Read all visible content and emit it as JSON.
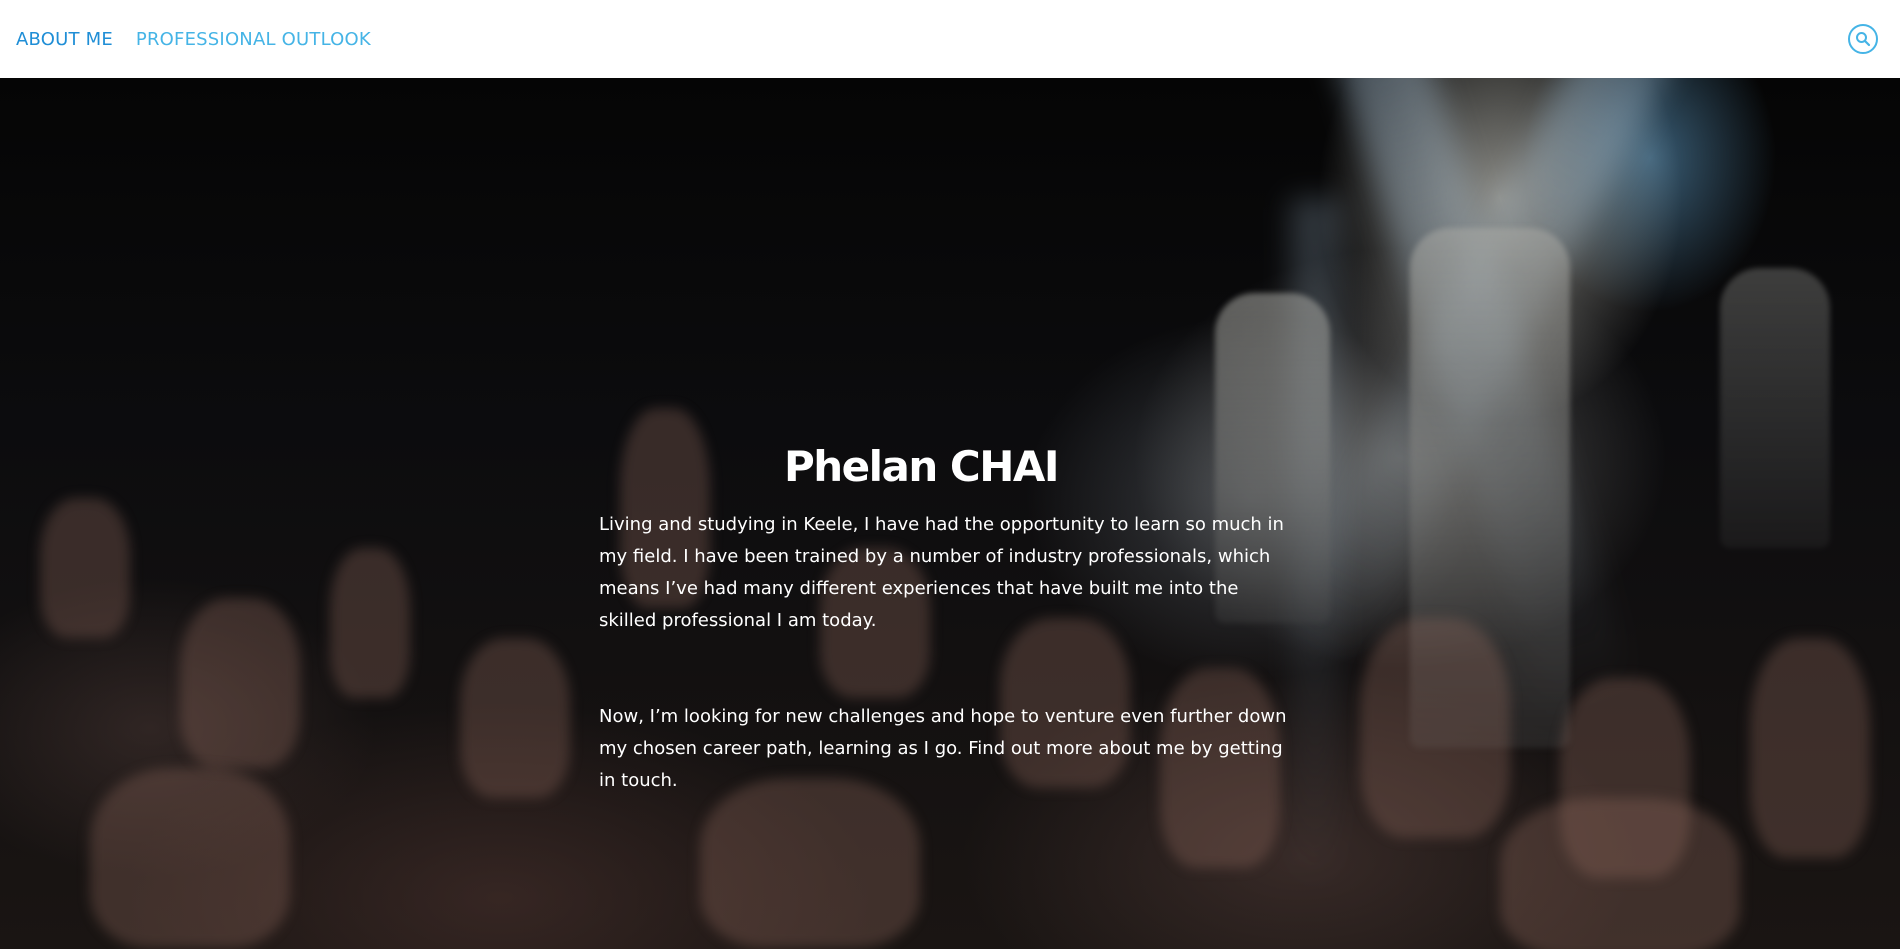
{
  "nav": {
    "items": [
      {
        "label": "ABOUT ME",
        "active": true
      },
      {
        "label": "PROFESSIONAL OUTLOOK",
        "active": false
      }
    ],
    "search_icon": "search-icon"
  },
  "colors": {
    "nav_active": "#1f8ed6",
    "nav_inactive": "#45b4e6",
    "header_bg": "#ffffff",
    "hero_text": "#ffffff"
  },
  "hero": {
    "background_image": "concert-crowd-photo",
    "title": "Phelan CHAI",
    "paragraphs": [
      "Living and studying in Keele, I have had the opportunity to learn so much in my field. I have been trained by a number of industry professionals, which means I’ve had many different experiences that have built me into the skilled professional I am today.",
      "Now, I’m looking for new challenges and hope to venture even further down my chosen career path, learning as I go. Find out more about me by getting in touch."
    ]
  }
}
